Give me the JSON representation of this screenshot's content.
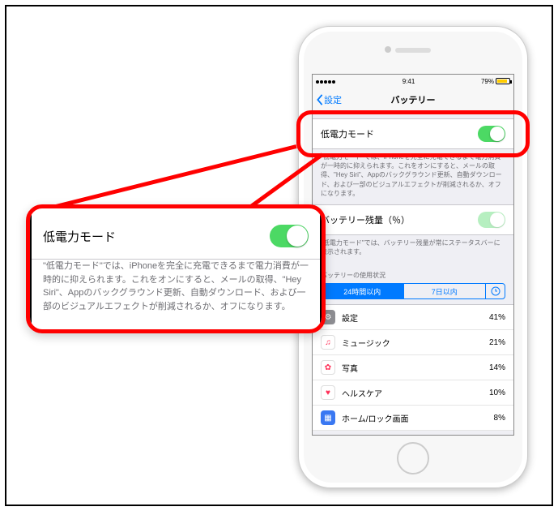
{
  "statusbar": {
    "time": "9:41",
    "battery_pct": "79%"
  },
  "navbar": {
    "back_label": "設定",
    "title": "バッテリー"
  },
  "low_power": {
    "label": "低電力モード",
    "description": "\"低電力モード\"では、iPhoneを完全に充電できるまで電力消費が一時的に抑えられます。これをオンにすると、メールの取得、\"Hey Siri\"、Appのバックグラウンド更新、自動ダウンロード、および一部のビジュアルエフェクトが削減されるか、オフになります。"
  },
  "battery_percent": {
    "label": "バッテリー残量（％）",
    "description": "\"低電力モード\"では、バッテリー残量が常にステータスバーに表示されます。"
  },
  "usage": {
    "header": "バッテリーの使用状況",
    "seg24": "24時間以内",
    "seg7": "7日以内",
    "rows": [
      {
        "name": "設定",
        "pct": "41%",
        "icon_bg": "#8e8e93",
        "glyph": "⚙"
      },
      {
        "name": "ミュージック",
        "pct": "21%",
        "icon_bg": "#ffffff",
        "glyph": "♫"
      },
      {
        "name": "写真",
        "pct": "14%",
        "icon_bg": "#ffffff",
        "glyph": "✿"
      },
      {
        "name": "ヘルスケア",
        "pct": "10%",
        "icon_bg": "#ffffff",
        "glyph": "♥"
      },
      {
        "name": "ホーム/ロック画面",
        "pct": "8%",
        "icon_bg": "#3a78f2",
        "glyph": "▦"
      }
    ]
  }
}
